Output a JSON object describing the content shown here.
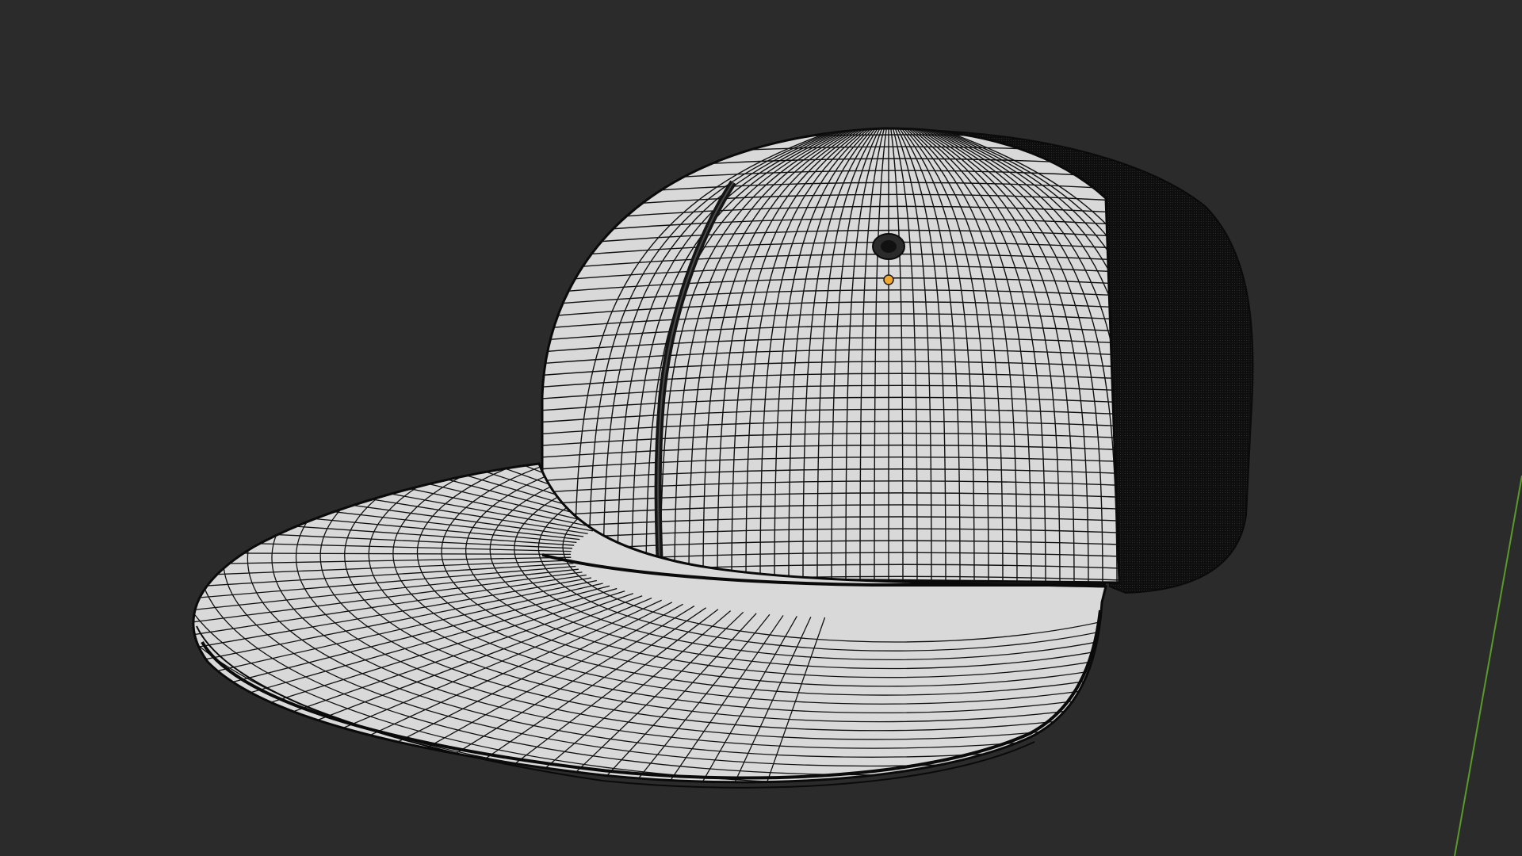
{
  "viewport": {
    "background": "#2b2b2b",
    "mode": "wireframe-overlay"
  },
  "object": {
    "type": "snapback-cap-mesh",
    "front_panel_color": "#d9d9d9",
    "mesh_panel_color": "#111111",
    "wire_color": "#101010",
    "origin_color": "#f0a830"
  },
  "axis": {
    "name": "y-axis",
    "color": "#5a9a2a"
  }
}
